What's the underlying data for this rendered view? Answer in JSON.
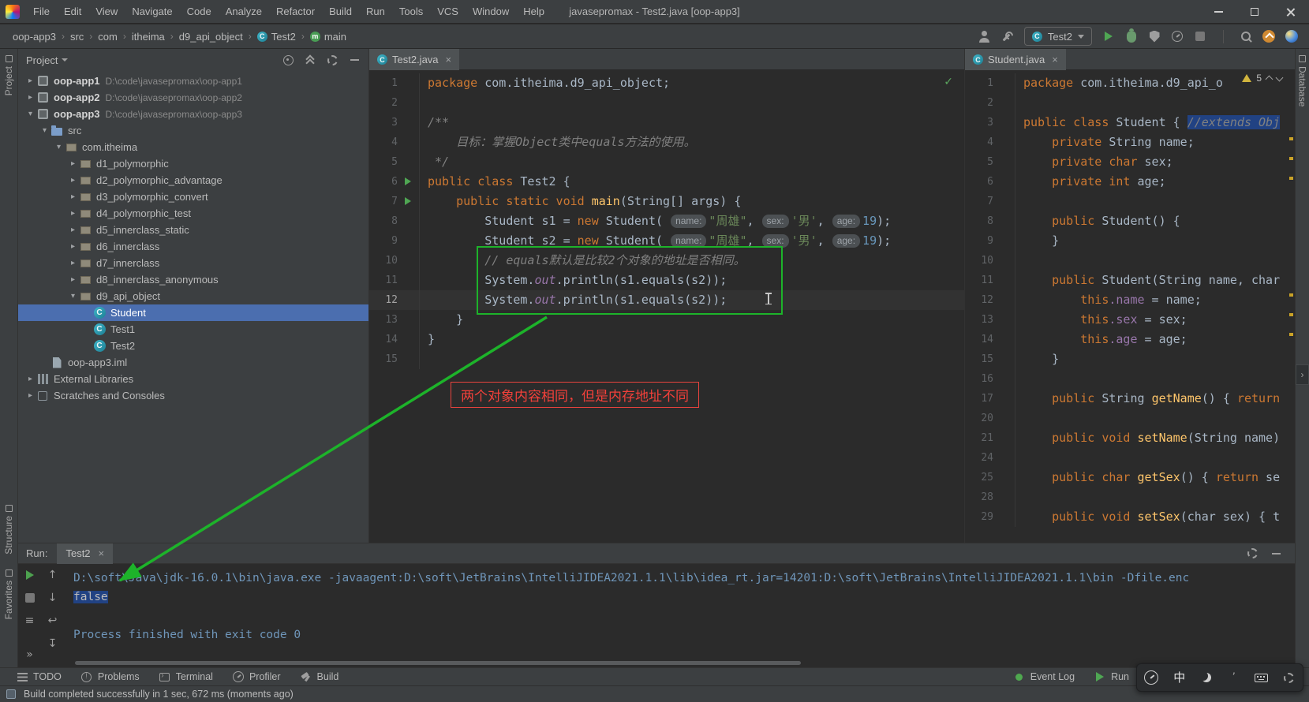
{
  "titlebar": {
    "menus": [
      "File",
      "Edit",
      "View",
      "Navigate",
      "Code",
      "Analyze",
      "Refactor",
      "Build",
      "Run",
      "Tools",
      "VCS",
      "Window",
      "Help"
    ],
    "title": "javasepromax - Test2.java [oop-app3]"
  },
  "navbar": {
    "separator": "›",
    "breadcrumbs": [
      {
        "label": "oop-app3"
      },
      {
        "label": "src"
      },
      {
        "label": "com"
      },
      {
        "label": "itheima"
      },
      {
        "label": "d9_api_object"
      },
      {
        "label": "Test2",
        "icon": "class"
      },
      {
        "label": "main",
        "icon": "method"
      }
    ],
    "run_config": "Test2",
    "icons_before_combo": [
      "user-icon",
      "build-hammer-icon"
    ],
    "icons_after_combo": [
      "run-icon",
      "debug-icon",
      "coverage-icon",
      "profiler-icon",
      "stop-icon",
      "divider",
      "search-icon",
      "update-icon",
      "gradle-sphere-icon"
    ]
  },
  "strips": {
    "left_top": "Project",
    "left_bottom": [
      "Structure",
      "Favorites"
    ],
    "right_top": "Database"
  },
  "project_panel": {
    "title": "Project",
    "header_icons": [
      "locate-icon",
      "collapse-all-icon",
      "settings-gear-icon",
      "hide-icon"
    ],
    "tree": [
      {
        "label": "oop-app1",
        "path": "D:\\code\\javasepromax\\oop-app1",
        "depth": 0,
        "arrow": "right",
        "icon": "module",
        "bold": true
      },
      {
        "label": "oop-app2",
        "path": "D:\\code\\javasepromax\\oop-app2",
        "depth": 0,
        "arrow": "right",
        "icon": "module",
        "bold": true
      },
      {
        "label": "oop-app3",
        "path": "D:\\code\\javasepromax\\oop-app3",
        "depth": 0,
        "arrow": "down",
        "icon": "module",
        "bold": true
      },
      {
        "label": "src",
        "depth": 1,
        "arrow": "down",
        "icon": "folder"
      },
      {
        "label": "com.itheima",
        "depth": 2,
        "arrow": "down",
        "icon": "package"
      },
      {
        "label": "d1_polymorphic",
        "depth": 3,
        "arrow": "right",
        "icon": "package"
      },
      {
        "label": "d2_polymorphic_advantage",
        "depth": 3,
        "arrow": "right",
        "icon": "package"
      },
      {
        "label": "d3_polymorphic_convert",
        "depth": 3,
        "arrow": "right",
        "icon": "package"
      },
      {
        "label": "d4_polymorphic_test",
        "depth": 3,
        "arrow": "right",
        "icon": "package"
      },
      {
        "label": "d5_innerclass_static",
        "depth": 3,
        "arrow": "right",
        "icon": "package"
      },
      {
        "label": "d6_innerclass",
        "depth": 3,
        "arrow": "right",
        "icon": "package"
      },
      {
        "label": "d7_innerclass",
        "depth": 3,
        "arrow": "right",
        "icon": "package"
      },
      {
        "label": "d8_innerclass_anonymous",
        "depth": 3,
        "arrow": "right",
        "icon": "package"
      },
      {
        "label": "d9_api_object",
        "depth": 3,
        "arrow": "down",
        "icon": "package"
      },
      {
        "label": "Student",
        "depth": 4,
        "icon": "class",
        "selected": true
      },
      {
        "label": "Test1",
        "depth": 4,
        "icon": "class"
      },
      {
        "label": "Test2",
        "depth": 4,
        "icon": "class"
      },
      {
        "label": "oop-app3.iml",
        "depth": 1,
        "icon": "file"
      },
      {
        "label": "External Libraries",
        "depth": 0,
        "arrow": "right",
        "icon": "lib"
      },
      {
        "label": "Scratches and Consoles",
        "depth": 0,
        "arrow": "right",
        "icon": "scratch"
      }
    ]
  },
  "editor_left": {
    "tab": "Test2.java",
    "lines": [
      {
        "n": "1",
        "t": [
          [
            "k",
            "package"
          ],
          [
            "d",
            " com.itheima.d9_api_object;"
          ]
        ]
      },
      {
        "n": "2",
        "t": []
      },
      {
        "n": "3",
        "t": [
          [
            "c",
            "/**"
          ]
        ]
      },
      {
        "n": "4",
        "t": [
          [
            "c",
            "    目标：掌握Object类中equals方法的使用。"
          ]
        ]
      },
      {
        "n": "5",
        "t": [
          [
            "c",
            " */"
          ]
        ]
      },
      {
        "n": "6",
        "g": "run",
        "t": [
          [
            "k",
            "public class "
          ],
          [
            "d",
            "Test2 {"
          ]
        ]
      },
      {
        "n": "7",
        "g": "run",
        "t": [
          [
            "d",
            "    "
          ],
          [
            "k",
            "public static void "
          ],
          [
            "m",
            "main"
          ],
          [
            "d",
            "(String[] args) {"
          ]
        ]
      },
      {
        "n": "8",
        "t": [
          [
            "d",
            "        Student s1 = "
          ],
          [
            "k",
            "new"
          ],
          [
            "d",
            " Student( "
          ],
          [
            "h",
            "name:"
          ],
          [
            "s",
            "\"周雄\""
          ],
          [
            "d",
            ", "
          ],
          [
            "h",
            "sex:"
          ],
          [
            "s",
            "'男'"
          ],
          [
            "d",
            ", "
          ],
          [
            "h",
            "age:"
          ],
          [
            "n",
            "19"
          ],
          [
            "d",
            ");"
          ]
        ]
      },
      {
        "n": "9",
        "t": [
          [
            "d",
            "        Student s2 = "
          ],
          [
            "k",
            "new"
          ],
          [
            "d",
            " Student( "
          ],
          [
            "h",
            "name:"
          ],
          [
            "s",
            "\"周雄\""
          ],
          [
            "d",
            ", "
          ],
          [
            "h",
            "sex:"
          ],
          [
            "s",
            "'男'"
          ],
          [
            "d",
            ", "
          ],
          [
            "h",
            "age:"
          ],
          [
            "n",
            "19"
          ],
          [
            "d",
            ");"
          ]
        ]
      },
      {
        "n": "10",
        "t": [
          [
            "c",
            "        // equals默认是比较2个对象的地址是否相同。"
          ]
        ]
      },
      {
        "n": "11",
        "t": [
          [
            "d",
            "        System."
          ],
          [
            "fi",
            "out"
          ],
          [
            "d",
            ".println(s1.equals(s2));"
          ]
        ]
      },
      {
        "n": "12",
        "caret": true,
        "t": [
          [
            "d",
            "        System."
          ],
          [
            "fi",
            "out"
          ],
          [
            "d",
            ".println(s1.equals(s2));"
          ]
        ]
      },
      {
        "n": "13",
        "t": [
          [
            "d",
            "    }"
          ]
        ]
      },
      {
        "n": "14",
        "t": [
          [
            "d",
            "}"
          ]
        ]
      },
      {
        "n": "15",
        "t": []
      }
    ]
  },
  "editor_right": {
    "tab": "Student.java",
    "warnings": "5",
    "lines": [
      {
        "n": "1",
        "t": [
          [
            "k",
            "package"
          ],
          [
            "d",
            " com.itheima.d9_api_o"
          ]
        ]
      },
      {
        "n": "2",
        "t": []
      },
      {
        "n": "3",
        "t": [
          [
            "k",
            "public class "
          ],
          [
            "d",
            "Student { "
          ],
          [
            "c sel",
            "//extends Obj"
          ]
        ]
      },
      {
        "n": "4",
        "t": [
          [
            "d",
            "    "
          ],
          [
            "k",
            "private "
          ],
          [
            "d",
            "String name;"
          ]
        ]
      },
      {
        "n": "5",
        "t": [
          [
            "d",
            "    "
          ],
          [
            "k",
            "private char "
          ],
          [
            "d",
            "sex;"
          ]
        ]
      },
      {
        "n": "6",
        "t": [
          [
            "d",
            "    "
          ],
          [
            "k",
            "private int "
          ],
          [
            "d",
            "age;"
          ]
        ]
      },
      {
        "n": "7",
        "t": []
      },
      {
        "n": "8",
        "t": [
          [
            "d",
            "    "
          ],
          [
            "k",
            "public "
          ],
          [
            "d",
            "Student() {"
          ]
        ]
      },
      {
        "n": "9",
        "t": [
          [
            "d",
            "    }"
          ]
        ]
      },
      {
        "n": "10",
        "t": []
      },
      {
        "n": "11",
        "t": [
          [
            "d",
            "    "
          ],
          [
            "k",
            "public "
          ],
          [
            "d",
            "Student(String name, char"
          ]
        ]
      },
      {
        "n": "12",
        "t": [
          [
            "d",
            "        "
          ],
          [
            "k",
            "this"
          ],
          [
            "f",
            ".name"
          ],
          [
            "d",
            " = name;"
          ]
        ]
      },
      {
        "n": "13",
        "t": [
          [
            "d",
            "        "
          ],
          [
            "k",
            "this"
          ],
          [
            "f",
            ".sex"
          ],
          [
            "d",
            " = sex;"
          ]
        ]
      },
      {
        "n": "14",
        "t": [
          [
            "d",
            "        "
          ],
          [
            "k",
            "this"
          ],
          [
            "f",
            ".age"
          ],
          [
            "d",
            " = age;"
          ]
        ]
      },
      {
        "n": "15",
        "t": [
          [
            "d",
            "    }"
          ]
        ]
      },
      {
        "n": "16",
        "t": []
      },
      {
        "n": "17",
        "t": [
          [
            "d",
            "    "
          ],
          [
            "k",
            "public "
          ],
          [
            "d",
            "String "
          ],
          [
            "m",
            "getName"
          ],
          [
            "d",
            "() { "
          ],
          [
            "k",
            "return"
          ]
        ]
      },
      {
        "n": "20",
        "t": []
      },
      {
        "n": "21",
        "t": [
          [
            "d",
            "    "
          ],
          [
            "k",
            "public void "
          ],
          [
            "m",
            "setName"
          ],
          [
            "d",
            "(String name)"
          ]
        ]
      },
      {
        "n": "24",
        "t": []
      },
      {
        "n": "25",
        "t": [
          [
            "d",
            "    "
          ],
          [
            "k",
            "public char "
          ],
          [
            "m",
            "getSex"
          ],
          [
            "d",
            "() { "
          ],
          [
            "k",
            "return"
          ],
          [
            "d",
            " se"
          ]
        ]
      },
      {
        "n": "28",
        "t": []
      },
      {
        "n": "29",
        "t": [
          [
            "d",
            "    "
          ],
          [
            "k",
            "public void "
          ],
          [
            "m",
            "setSex"
          ],
          [
            "d",
            "(char sex) { t"
          ]
        ]
      }
    ]
  },
  "overlay": {
    "note": "两个对象内容相同，但是内存地址不同"
  },
  "run_panel": {
    "label": "Run:",
    "tab": "Test2",
    "header_icons": [
      "settings-gear-icon",
      "hide-icon"
    ],
    "toolbar_main": [
      "rerun-icon",
      "stop-icon",
      "pin-icon",
      "more-icon"
    ],
    "toolbar_console": [
      "up-stack-icon",
      "down-stack-icon",
      "soft-wrap-icon",
      "scroll-end-icon"
    ],
    "console": [
      [
        [
          "cmd",
          "D:\\soft\\Java\\jdk-16.0.1\\bin\\java.exe -javaagent:D:\\soft\\JetBrains\\IntelliJIDEA2021.1.1\\lib\\idea_rt.jar=14201:D:\\soft\\JetBrains\\IntelliJIDEA2021.1.1\\bin -Dfile.enc"
        ]
      ],
      [
        [
          "out sel",
          "false"
        ]
      ],
      [],
      [
        [
          "cmd",
          "Process finished with exit code 0"
        ]
      ]
    ]
  },
  "bottom_bar": {
    "items": [
      {
        "label": "TODO",
        "icon": "todo-icon"
      },
      {
        "label": "Problems",
        "icon": "problems-icon"
      },
      {
        "label": "Terminal",
        "icon": "terminal-icon"
      },
      {
        "label": "Profiler",
        "icon": "profiler-icon"
      },
      {
        "label": "Build",
        "icon": "build-icon"
      }
    ],
    "right": [
      {
        "label": "Event Log",
        "icon": "event-log-icon"
      },
      {
        "label": "Run",
        "icon": "run-icon"
      }
    ]
  },
  "status_bar": {
    "message": "Build completed successfully in 1 sec, 672 ms (moments ago)"
  },
  "ime_bar": {
    "mode_text": "中",
    "icons": [
      "gauge-icon",
      "chinese-mode-icon",
      "halfwidth-moon-icon",
      "punctuation-icon",
      "keyboard-icon",
      "settings-wrench-icon"
    ]
  }
}
